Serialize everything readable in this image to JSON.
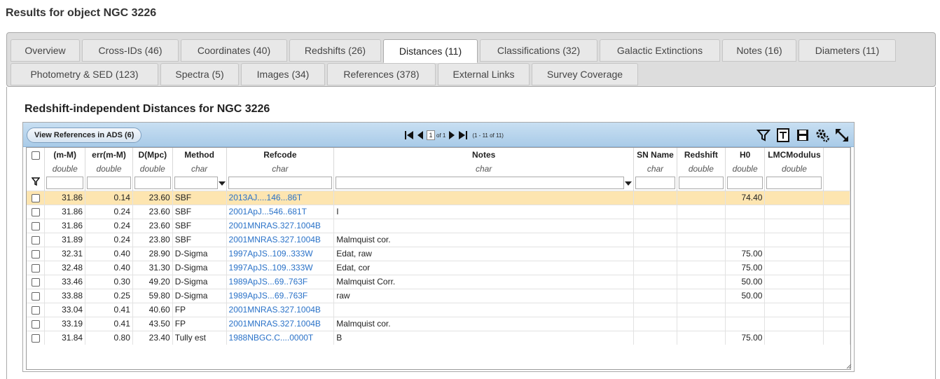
{
  "page": {
    "title": "Results for object NGC 3226"
  },
  "tabs": [
    {
      "label": "Overview"
    },
    {
      "label": "Cross-IDs (46)"
    },
    {
      "label": "Coordinates (40)"
    },
    {
      "label": "Redshifts (26)"
    },
    {
      "label": "Distances (11)",
      "active": true
    },
    {
      "label": "Classifications (32)"
    },
    {
      "label": "Galactic Extinctions"
    },
    {
      "label": "Notes (16)"
    },
    {
      "label": "Diameters (11)"
    },
    {
      "label": "Photometry & SED (123)"
    },
    {
      "label": "Spectra (5)"
    },
    {
      "label": "Images (34)"
    },
    {
      "label": "References (378)"
    },
    {
      "label": "External Links"
    },
    {
      "label": "Survey Coverage"
    }
  ],
  "section": {
    "title": "Redshift-independent Distances for NGC 3226"
  },
  "toolbar": {
    "ads_button": "View References in ADS (6)",
    "page_value": "1",
    "page_of": "of 1",
    "range": "(1 - 11 of 11)",
    "icons": [
      "filter-icon",
      "text-export-icon",
      "save-icon",
      "settings-icon",
      "expand-icon"
    ]
  },
  "columns": [
    {
      "name": "(m-M)",
      "type": "double"
    },
    {
      "name": "err(m-M)",
      "type": "double"
    },
    {
      "name": "D(Mpc)",
      "type": "double"
    },
    {
      "name": "Method",
      "type": "char"
    },
    {
      "name": "Refcode",
      "type": "char"
    },
    {
      "name": "Notes",
      "type": "char"
    },
    {
      "name": "SN Name",
      "type": "char"
    },
    {
      "name": "Redshift",
      "type": "double"
    },
    {
      "name": "H0",
      "type": "double"
    },
    {
      "name": "LMCModulus",
      "type": "double"
    }
  ],
  "rows": [
    {
      "mm": "31.86",
      "err": "0.14",
      "d": "23.60",
      "method": "SBF",
      "ref": "2013AJ....146...86T",
      "notes": "",
      "sn": "",
      "z": "",
      "h0": "74.40",
      "lmc": "",
      "highlight": true
    },
    {
      "mm": "31.86",
      "err": "0.24",
      "d": "23.60",
      "method": "SBF",
      "ref": "2001ApJ...546..681T",
      "notes": "I",
      "sn": "",
      "z": "",
      "h0": "",
      "lmc": ""
    },
    {
      "mm": "31.86",
      "err": "0.24",
      "d": "23.60",
      "method": "SBF",
      "ref": "2001MNRAS.327.1004B",
      "notes": "",
      "sn": "",
      "z": "",
      "h0": "",
      "lmc": ""
    },
    {
      "mm": "31.89",
      "err": "0.24",
      "d": "23.80",
      "method": "SBF",
      "ref": "2001MNRAS.327.1004B",
      "notes": "Malmquist cor.",
      "sn": "",
      "z": "",
      "h0": "",
      "lmc": ""
    },
    {
      "mm": "32.31",
      "err": "0.40",
      "d": "28.90",
      "method": "D-Sigma",
      "ref": "1997ApJS..109..333W",
      "notes": "Edat, raw",
      "sn": "",
      "z": "",
      "h0": "75.00",
      "lmc": ""
    },
    {
      "mm": "32.48",
      "err": "0.40",
      "d": "31.30",
      "method": "D-Sigma",
      "ref": "1997ApJS..109..333W",
      "notes": "Edat, cor",
      "sn": "",
      "z": "",
      "h0": "75.00",
      "lmc": ""
    },
    {
      "mm": "33.46",
      "err": "0.30",
      "d": "49.20",
      "method": "D-Sigma",
      "ref": "1989ApJS...69..763F",
      "notes": "Malmquist Corr.",
      "sn": "",
      "z": "",
      "h0": "50.00",
      "lmc": ""
    },
    {
      "mm": "33.88",
      "err": "0.25",
      "d": "59.80",
      "method": "D-Sigma",
      "ref": "1989ApJS...69..763F",
      "notes": "raw",
      "sn": "",
      "z": "",
      "h0": "50.00",
      "lmc": ""
    },
    {
      "mm": "33.04",
      "err": "0.41",
      "d": "40.60",
      "method": "FP",
      "ref": "2001MNRAS.327.1004B",
      "notes": "",
      "sn": "",
      "z": "",
      "h0": "",
      "lmc": ""
    },
    {
      "mm": "33.19",
      "err": "0.41",
      "d": "43.50",
      "method": "FP",
      "ref": "2001MNRAS.327.1004B",
      "notes": "Malmquist cor.",
      "sn": "",
      "z": "",
      "h0": "",
      "lmc": ""
    },
    {
      "mm": "31.84",
      "err": "0.80",
      "d": "23.40",
      "method": "Tully est",
      "ref": "1988NBGC.C....0000T",
      "notes": "B",
      "sn": "",
      "z": "",
      "h0": "75.00",
      "lmc": ""
    }
  ]
}
